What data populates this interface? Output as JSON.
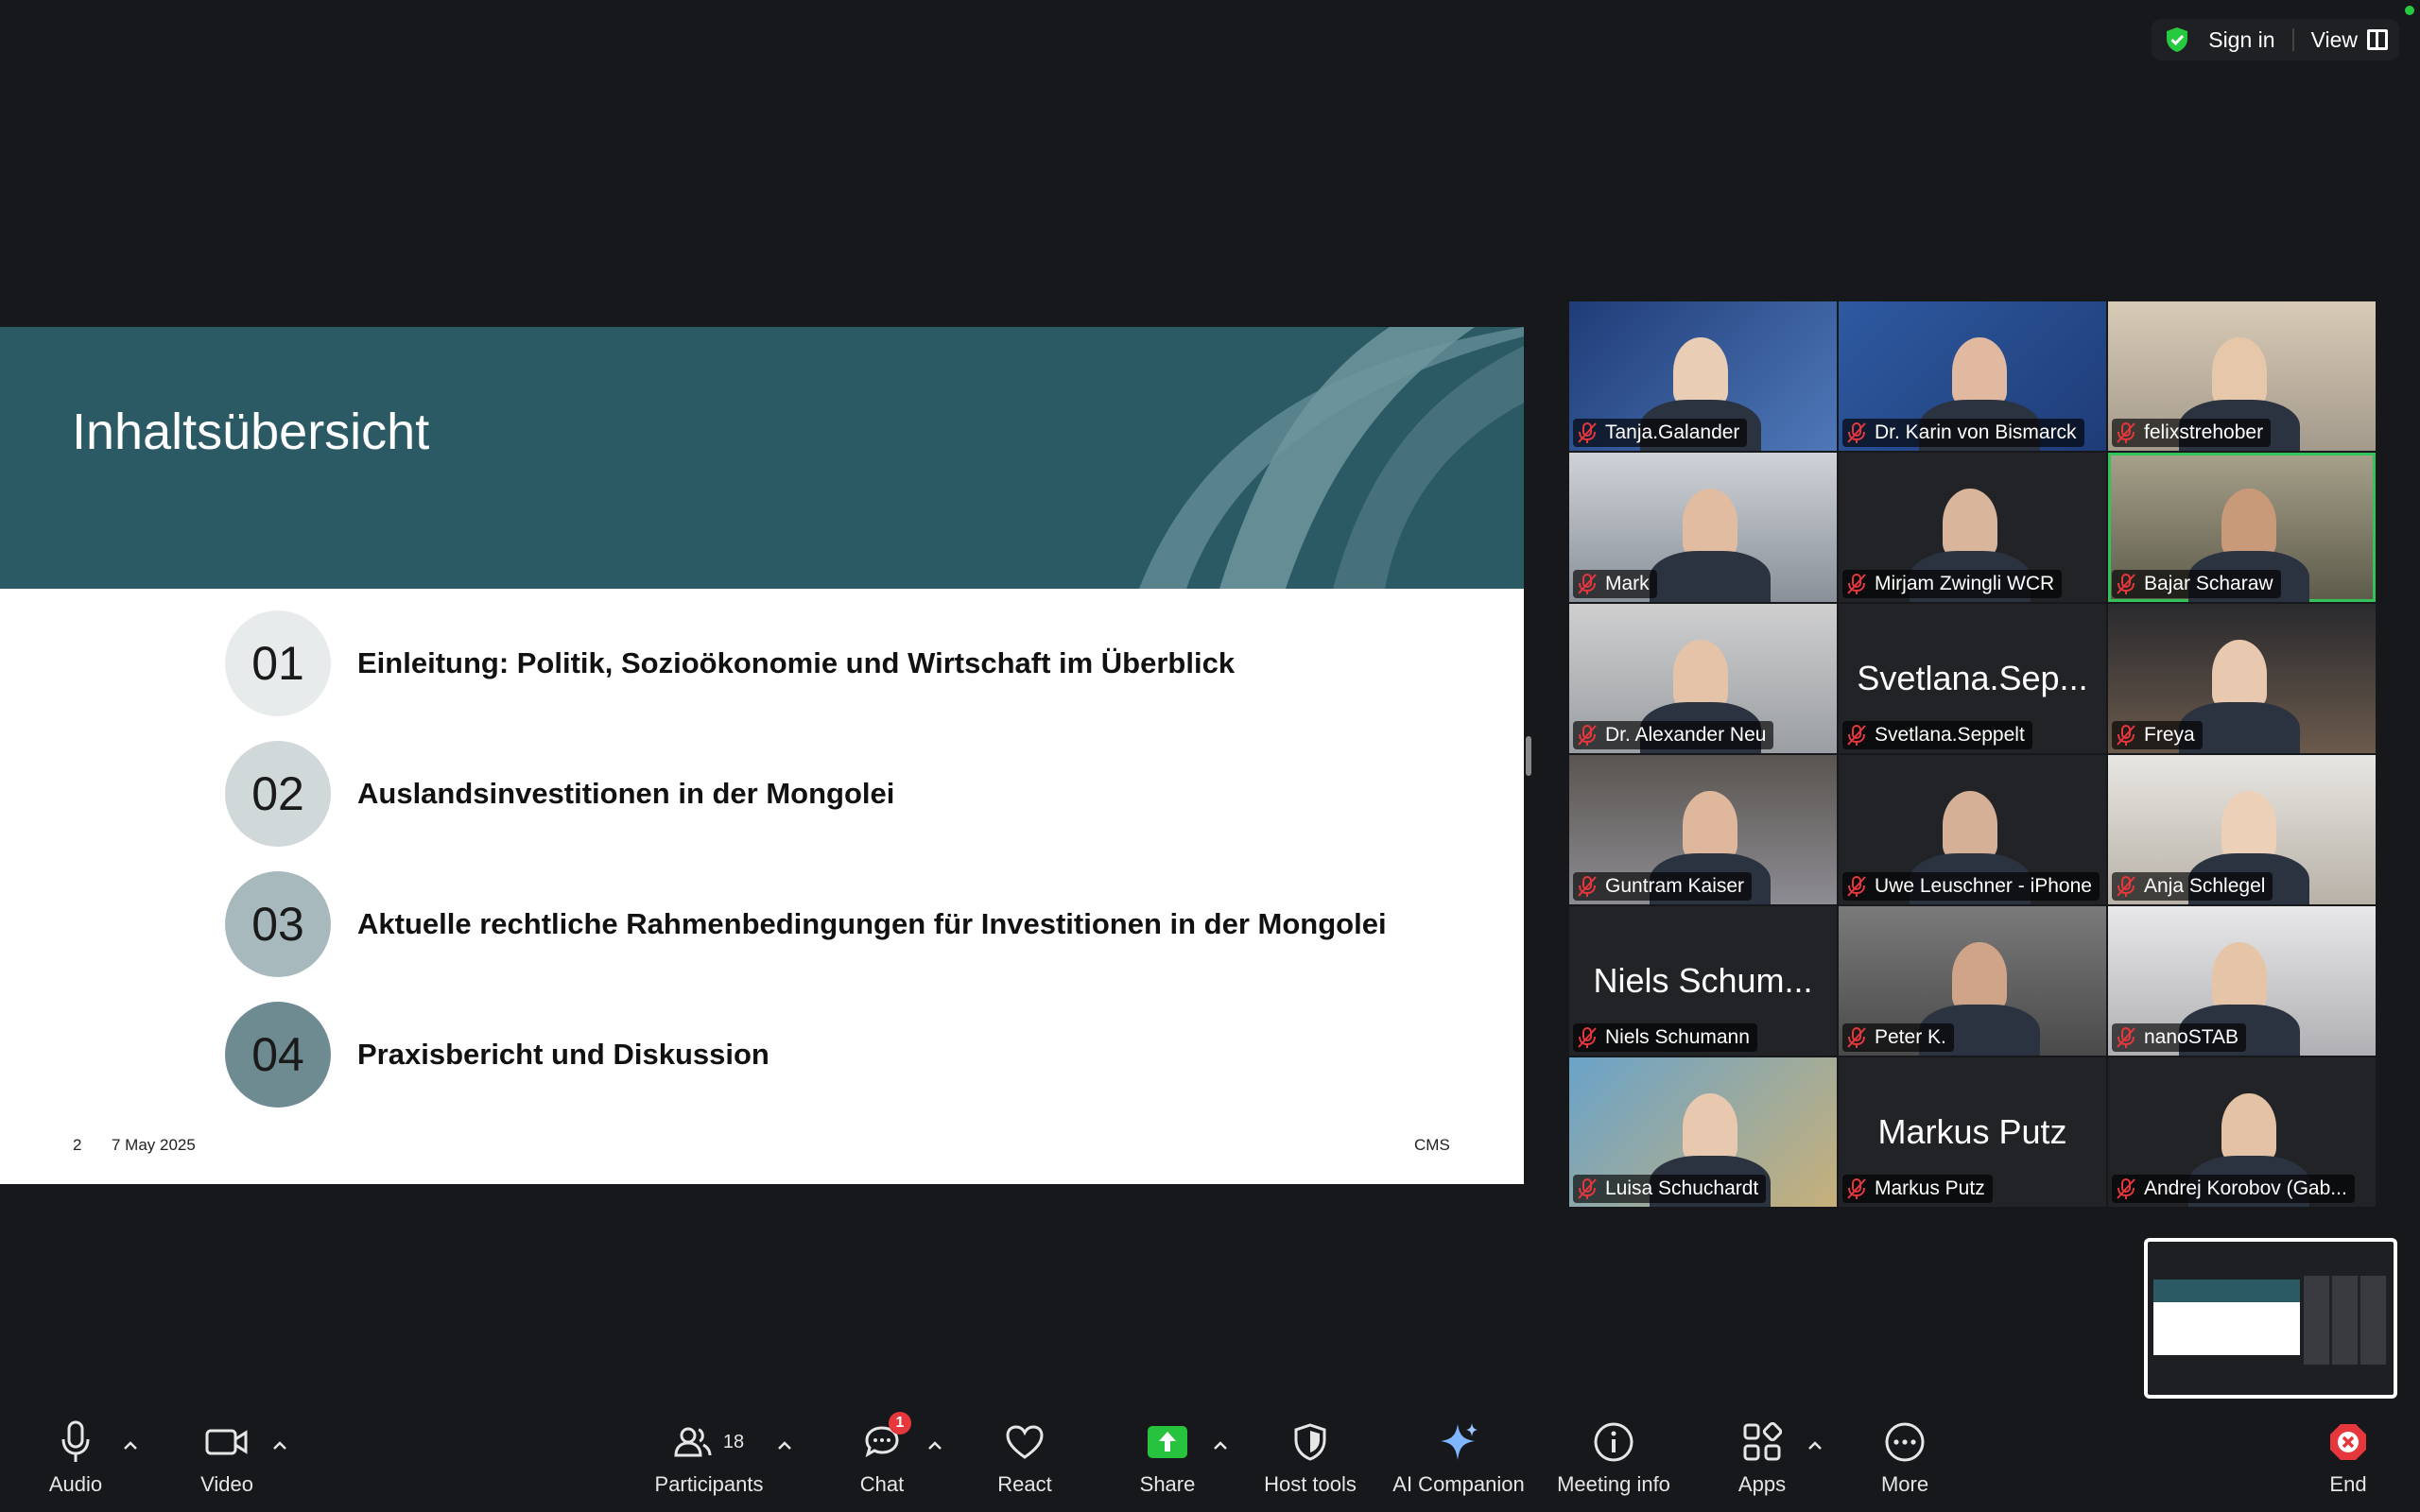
{
  "topbar": {
    "sign_in": "Sign in",
    "view": "View"
  },
  "slide": {
    "title": "Inhaltsübersicht",
    "items": [
      {
        "num": "01",
        "text": "Einleitung: Politik, Sozioökonomie und Wirtschaft im Überblick",
        "color": "#e8ebec"
      },
      {
        "num": "02",
        "text": "Auslandsinvestitionen in der Mongolei",
        "color": "#d0d8da"
      },
      {
        "num": "03",
        "text": "Aktuelle rechtliche Rahmenbedingungen für Investitionen in der Mongolei",
        "color": "#a7b9bd"
      },
      {
        "num": "04",
        "text": "Praxisbericht und Diskussion",
        "color": "#6f8b92"
      }
    ],
    "page_number": "2",
    "date": "7 May 2025",
    "brand": "CMS",
    "header_color": "#2b5a64"
  },
  "participants_grid": [
    {
      "name": "Tanja.Galander"
    },
    {
      "name": "Dr. Karin von Bismarck"
    },
    {
      "name": "felixstrehober"
    },
    {
      "name": "Mark"
    },
    {
      "name": "Mirjam Zwingli WCR"
    },
    {
      "name": "Bajar Scharaw",
      "active": true
    },
    {
      "name": "Dr. Alexander Neu"
    },
    {
      "name": "Svetlana.Seppelt",
      "display": "Svetlana.Sep..."
    },
    {
      "name": "Freya"
    },
    {
      "name": "Guntram Kaiser"
    },
    {
      "name": "Uwe Leuschner - iPhone"
    },
    {
      "name": "Anja Schlegel"
    },
    {
      "name": "Niels Schumann",
      "display": "Niels Schum..."
    },
    {
      "name": "Peter K."
    },
    {
      "name": "nanoSTAB"
    },
    {
      "name": "Luisa Schuchardt"
    },
    {
      "name": "Markus Putz",
      "display": "Markus Putz"
    },
    {
      "name": "Andrej Korobov (Gab..."
    }
  ],
  "toolbar": {
    "audio": "Audio",
    "video": "Video",
    "participants": "Participants",
    "participants_count": "18",
    "chat": "Chat",
    "chat_badge": "1",
    "react": "React",
    "share": "Share",
    "host_tools": "Host tools",
    "ai_companion": "AI Companion",
    "meeting_info": "Meeting info",
    "apps": "Apps",
    "more": "More",
    "end": "End"
  }
}
